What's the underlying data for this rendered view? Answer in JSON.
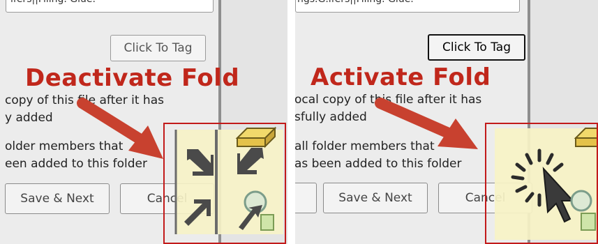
{
  "left": {
    "top_field_text": "ifers||Filing. Glue.",
    "tag_button_label": "Click To Tag",
    "title": "Deactivate Fold",
    "line1": "copy of this file after it has",
    "line2": "y added",
    "line3": "older members that",
    "line4": "een added to this folder",
    "save_next_label": "Save & Next",
    "cancel_label": "Cancel"
  },
  "right": {
    "top_field_text": "ngs.G.ifers||Filing. Glue.",
    "tag_button_label": "Click To Tag",
    "title": "Activate Fold",
    "line1": "ocal copy of this file after it has",
    "line2": "sfully added",
    "line3": "all folder members that",
    "line4": "as been added to this folder",
    "save_next_label": "Save & Next",
    "cancel_label": "Cancel"
  },
  "icons": {
    "left_buttons": [
      "collapse-arrows-icon",
      "collapse-arrows-icon",
      "fold-arrow-icon",
      "fold-arrow-icon"
    ],
    "right_buttons": [
      "busy-spinner-icon",
      "cursor-icon"
    ],
    "folder": "folder-icon",
    "magnifier": "magnifier-icon"
  },
  "colors": {
    "annotation_red": "#c0271b",
    "highlight_box": "#c21a1a",
    "fold_panel_bg": "#f7f3c6",
    "arrow_gray": "#444444"
  }
}
